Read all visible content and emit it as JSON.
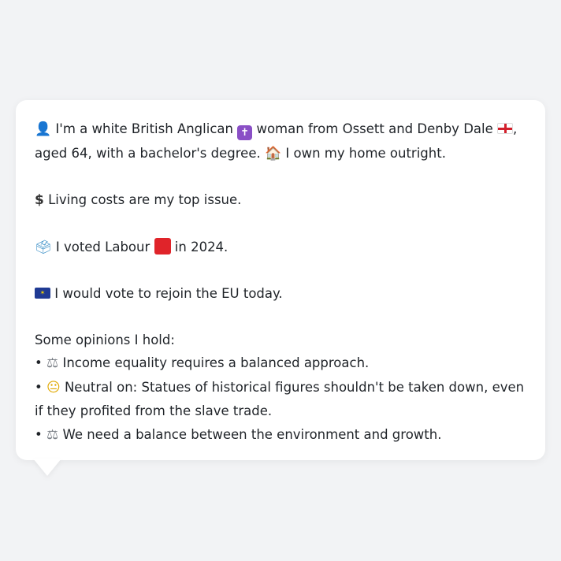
{
  "profile": {
    "line1_a": "I'm a white British Anglican",
    "line1_b": "woman from Ossett and Denby Dale",
    "line1_c": ",",
    "line1_d": "aged 64, with a bachelor's degree.",
    "line1_e": "I own my home outright."
  },
  "issue": {
    "text": "Living costs are my top issue."
  },
  "vote": {
    "text_a": "I voted Labour",
    "text_b": "in 2024."
  },
  "eu": {
    "text": "I would vote to rejoin the EU today."
  },
  "opinions": {
    "heading": "Some opinions I hold:",
    "items": [
      {
        "bullet": "•",
        "text": "Income equality requires a balanced approach."
      },
      {
        "bullet": "•",
        "text": "Neutral on: Statues of historical figures shouldn't be taken down, even if they profited from the slave trade."
      },
      {
        "bullet": "•",
        "text": "We need a balance between the environment and growth."
      }
    ]
  },
  "colors": {
    "background": "#f2f3f5",
    "bubble": "#ffffff",
    "text": "#1f2328",
    "labour_red": "#e0242a",
    "anglican_purple": "#8a4fc6"
  }
}
